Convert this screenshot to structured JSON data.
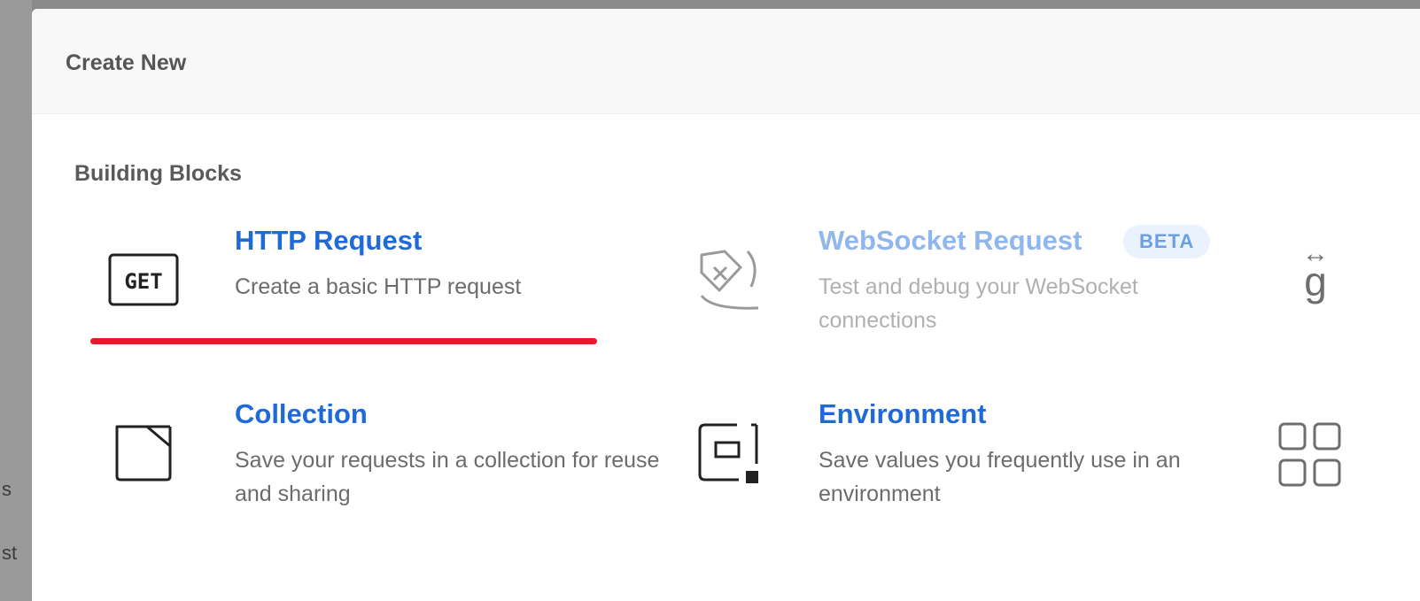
{
  "backdrop": {
    "fragments": [
      "s",
      "st"
    ]
  },
  "modal": {
    "title": "Create New",
    "section_title": "Building Blocks",
    "cards": [
      {
        "title": "HTTP Request",
        "description": "Create a basic HTTP request",
        "icon_name": "get-icon",
        "icon_text": "GET"
      },
      {
        "title": "WebSocket Request",
        "badge": "BETA",
        "description": "Test and debug your WebSocket connections",
        "icon_name": "websocket-icon",
        "disabled": true
      },
      {
        "title": "Collection",
        "description": "Save your requests in a collection for reuse and sharing",
        "icon_name": "folder-icon"
      },
      {
        "title": "Environment",
        "description": "Save values you frequently use in an environment",
        "icon_name": "environment-icon"
      }
    ],
    "right_icons": [
      {
        "name": "graphql-icon",
        "arrow": "↔",
        "letter": "g"
      },
      {
        "name": "grid-icon"
      }
    ]
  },
  "colors": {
    "link_blue": "#1f6ad6",
    "disabled_blue": "#8fb7ee",
    "underline_red": "#e8192a"
  }
}
